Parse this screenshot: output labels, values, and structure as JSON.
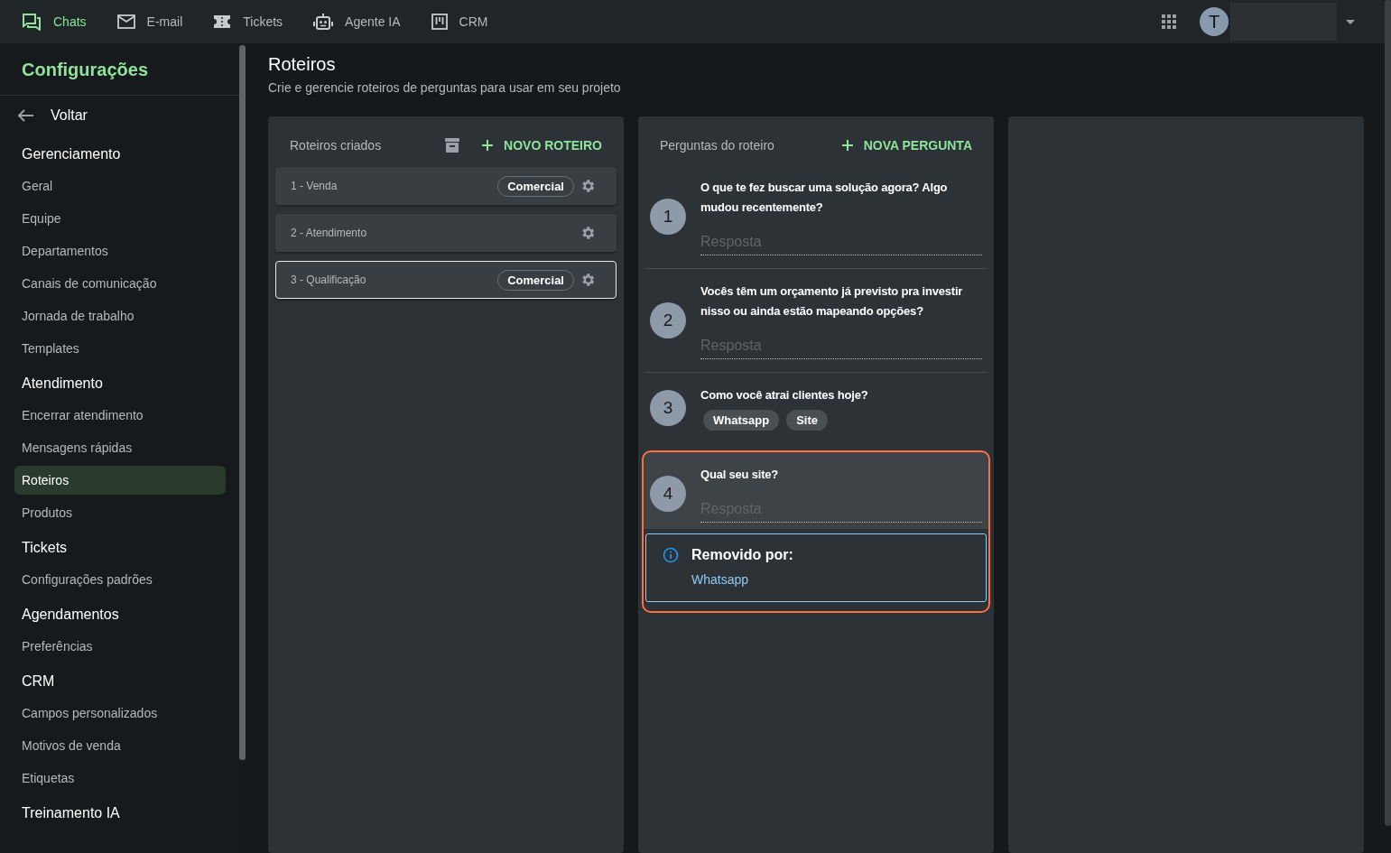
{
  "top_nav": {
    "items": [
      {
        "label": "Chats",
        "selected": true
      },
      {
        "label": "E-mail",
        "selected": false
      },
      {
        "label": "Tickets",
        "selected": false
      },
      {
        "label": "Agente IA",
        "selected": false
      },
      {
        "label": "CRM",
        "selected": false
      }
    ],
    "avatar": "T"
  },
  "sidebar": {
    "title": "Configurações",
    "back": "Voltar",
    "sections": [
      {
        "heading": "Gerenciamento",
        "items": [
          {
            "label": "Geral",
            "selected": false
          },
          {
            "label": "Equipe",
            "selected": false
          },
          {
            "label": "Departamentos",
            "selected": false
          },
          {
            "label": "Canais de comunicação",
            "selected": false
          },
          {
            "label": "Jornada de trabalho",
            "selected": false
          },
          {
            "label": "Templates",
            "selected": false
          }
        ]
      },
      {
        "heading": "Atendimento",
        "items": [
          {
            "label": "Encerrar atendimento",
            "selected": false
          },
          {
            "label": "Mensagens rápidas",
            "selected": false
          },
          {
            "label": "Roteiros",
            "selected": true
          },
          {
            "label": "Produtos",
            "selected": false
          }
        ]
      },
      {
        "heading": "Tickets",
        "items": [
          {
            "label": "Configurações padrões",
            "selected": false
          }
        ]
      },
      {
        "heading": "Agendamentos",
        "items": [
          {
            "label": "Preferências",
            "selected": false
          }
        ]
      },
      {
        "heading": "CRM",
        "items": [
          {
            "label": "Campos personalizados",
            "selected": false
          },
          {
            "label": "Motivos de venda",
            "selected": false
          },
          {
            "label": "Etiquetas",
            "selected": false
          }
        ]
      },
      {
        "heading": "Treinamento IA"
      }
    ]
  },
  "page": {
    "title": "Roteiros",
    "subtitle": "Crie e gerencie roteiros de perguntas para usar em seu projeto"
  },
  "scripts_panel": {
    "title": "Roteiros criados",
    "button": "NOVO ROTEIRO",
    "scripts": [
      {
        "label": "1 - Venda",
        "tag": "Comercial",
        "selected": false
      },
      {
        "label": "2 - Atendimento",
        "selected": false
      },
      {
        "label": "3 - Qualificação",
        "tag": "Comercial",
        "selected": true
      }
    ]
  },
  "questions_panel": {
    "title": "Perguntas do roteiro",
    "button": "NOVA PERGUNTA",
    "questions": [
      {
        "number": "1",
        "text": "O que te fez buscar uma solução agora? Algo mudou recentemente?",
        "kind": "text",
        "placeholder": "Resposta",
        "highlighted": false
      },
      {
        "number": "2",
        "text": "Vocês têm um orçamento já previsto pra investir nisso ou ainda estão mapeando opções?",
        "kind": "text",
        "placeholder": "Resposta",
        "highlighted": false
      },
      {
        "number": "3",
        "text": "Como você atrai clientes hoje?",
        "kind": "choice",
        "options": [
          "Whatsapp",
          "Site"
        ],
        "highlighted": false
      },
      {
        "number": "4",
        "text": "Qual seu site?",
        "kind": "text",
        "placeholder": "Resposta",
        "highlighted": true,
        "notice": {
          "title": "Removido por:",
          "body": "Whatsapp"
        }
      }
    ]
  }
}
